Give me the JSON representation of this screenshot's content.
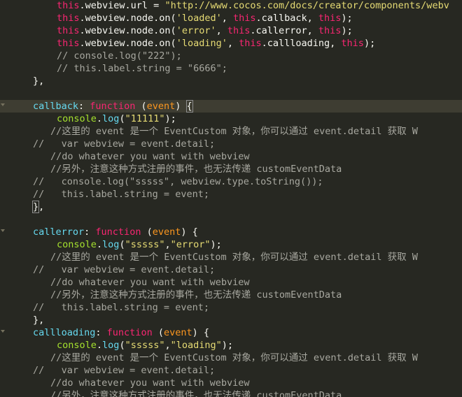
{
  "lines": [
    {
      "indent": "    ",
      "tokens": [
        {
          "t": "this",
          "c": "this"
        },
        {
          "t": ".webview.url = ",
          "c": "plain"
        },
        {
          "t": "\"http://www.cocos.com/docs/creator/components/webv",
          "c": "str"
        }
      ]
    },
    {
      "indent": "    ",
      "tokens": [
        {
          "t": "this",
          "c": "this"
        },
        {
          "t": ".webview.node.on(",
          "c": "plain"
        },
        {
          "t": "'loaded'",
          "c": "str"
        },
        {
          "t": ", ",
          "c": "plain"
        },
        {
          "t": "this",
          "c": "this"
        },
        {
          "t": ".callback, ",
          "c": "plain"
        },
        {
          "t": "this",
          "c": "this"
        },
        {
          "t": ");",
          "c": "plain"
        }
      ]
    },
    {
      "indent": "    ",
      "tokens": [
        {
          "t": "this",
          "c": "this"
        },
        {
          "t": ".webview.node.on(",
          "c": "plain"
        },
        {
          "t": "'error'",
          "c": "str"
        },
        {
          "t": ", ",
          "c": "plain"
        },
        {
          "t": "this",
          "c": "this"
        },
        {
          "t": ".callerror, ",
          "c": "plain"
        },
        {
          "t": "this",
          "c": "this"
        },
        {
          "t": ");",
          "c": "plain"
        }
      ]
    },
    {
      "indent": "    ",
      "tokens": [
        {
          "t": "this",
          "c": "this"
        },
        {
          "t": ".webview.node.on(",
          "c": "plain"
        },
        {
          "t": "'loading'",
          "c": "str"
        },
        {
          "t": ", ",
          "c": "plain"
        },
        {
          "t": "this",
          "c": "this"
        },
        {
          "t": ".callloading, ",
          "c": "plain"
        },
        {
          "t": "this",
          "c": "this"
        },
        {
          "t": ");",
          "c": "plain"
        }
      ]
    },
    {
      "indent": "    ",
      "tokens": [
        {
          "t": "// console.log(\"222\");",
          "c": "cmt"
        }
      ]
    },
    {
      "indent": "    ",
      "tokens": [
        {
          "t": "// this.label.string = \"6666\";",
          "c": "cmt"
        }
      ]
    },
    {
      "indent": "",
      "tokens": [
        {
          "t": "},",
          "c": "plain"
        }
      ]
    },
    {
      "indent": "",
      "tokens": []
    },
    {
      "indent": "",
      "fold": true,
      "active": true,
      "tokens": [
        {
          "t": "callback",
          "c": "fnname"
        },
        {
          "t": ": ",
          "c": "plain"
        },
        {
          "t": "function",
          "c": "kw"
        },
        {
          "t": " (",
          "c": "plain"
        },
        {
          "t": "event",
          "c": "param"
        },
        {
          "t": ") ",
          "c": "plain"
        },
        {
          "t": "{",
          "c": "plain",
          "hl": true
        }
      ]
    },
    {
      "indent": "    ",
      "tokens": [
        {
          "t": "console",
          "c": "fn"
        },
        {
          "t": ".",
          "c": "plain"
        },
        {
          "t": "log",
          "c": "method"
        },
        {
          "t": "(",
          "c": "plain"
        },
        {
          "t": "\"11111\"",
          "c": "str"
        },
        {
          "t": ");",
          "c": "plain"
        }
      ]
    },
    {
      "indent": "   ",
      "tokens": [
        {
          "t": "//这里的 event 是一个 EventCustom 对象，你可以通过 event.detail 获取 W",
          "c": "cmt"
        }
      ]
    },
    {
      "indent": "",
      "tokens": [
        {
          "t": "//   var webview = event.detail;",
          "c": "cmt"
        }
      ]
    },
    {
      "indent": "   ",
      "tokens": [
        {
          "t": "//do whatever you want with webview",
          "c": "cmt"
        }
      ]
    },
    {
      "indent": "   ",
      "tokens": [
        {
          "t": "//另外，注意这种方式注册的事件，也无法传递 customEventData",
          "c": "cmt"
        }
      ]
    },
    {
      "indent": "",
      "tokens": [
        {
          "t": "//   console.log(\"sssss\", webview.type.toString());",
          "c": "cmt"
        }
      ]
    },
    {
      "indent": "",
      "tokens": [
        {
          "t": "//   this.label.string = event;",
          "c": "cmt"
        }
      ]
    },
    {
      "indent": "",
      "tokens": [
        {
          "t": "}",
          "c": "plain",
          "hl": true
        },
        {
          "t": ",",
          "c": "plain"
        }
      ]
    },
    {
      "indent": "",
      "tokens": []
    },
    {
      "indent": "",
      "fold": true,
      "tokens": [
        {
          "t": "callerror",
          "c": "fnname"
        },
        {
          "t": ": ",
          "c": "plain"
        },
        {
          "t": "function",
          "c": "kw"
        },
        {
          "t": " (",
          "c": "plain"
        },
        {
          "t": "event",
          "c": "param"
        },
        {
          "t": ") {",
          "c": "plain"
        }
      ]
    },
    {
      "indent": "    ",
      "tokens": [
        {
          "t": "console",
          "c": "fn"
        },
        {
          "t": ".",
          "c": "plain"
        },
        {
          "t": "log",
          "c": "method"
        },
        {
          "t": "(",
          "c": "plain"
        },
        {
          "t": "\"sssss\"",
          "c": "str"
        },
        {
          "t": ",",
          "c": "plain"
        },
        {
          "t": "\"error\"",
          "c": "str"
        },
        {
          "t": ");",
          "c": "plain"
        }
      ]
    },
    {
      "indent": "   ",
      "tokens": [
        {
          "t": "//这里的 event 是一个 EventCustom 对象，你可以通过 event.detail 获取 W",
          "c": "cmt"
        }
      ]
    },
    {
      "indent": "",
      "tokens": [
        {
          "t": "//   var webview = event.detail;",
          "c": "cmt"
        }
      ]
    },
    {
      "indent": "   ",
      "tokens": [
        {
          "t": "//do whatever you want with webview",
          "c": "cmt"
        }
      ]
    },
    {
      "indent": "   ",
      "tokens": [
        {
          "t": "//另外，注意这种方式注册的事件，也无法传递 customEventData",
          "c": "cmt"
        }
      ]
    },
    {
      "indent": "",
      "tokens": [
        {
          "t": "//   this.label.string = event;",
          "c": "cmt"
        }
      ]
    },
    {
      "indent": "",
      "tokens": [
        {
          "t": "},",
          "c": "plain"
        }
      ]
    },
    {
      "indent": "",
      "fold": true,
      "tokens": [
        {
          "t": "callloading",
          "c": "fnname"
        },
        {
          "t": ": ",
          "c": "plain"
        },
        {
          "t": "function",
          "c": "kw"
        },
        {
          "t": " (",
          "c": "plain"
        },
        {
          "t": "event",
          "c": "param"
        },
        {
          "t": ") {",
          "c": "plain"
        }
      ]
    },
    {
      "indent": "    ",
      "tokens": [
        {
          "t": "console",
          "c": "fn"
        },
        {
          "t": ".",
          "c": "plain"
        },
        {
          "t": "log",
          "c": "method"
        },
        {
          "t": "(",
          "c": "plain"
        },
        {
          "t": "\"sssss\"",
          "c": "str"
        },
        {
          "t": ",",
          "c": "plain"
        },
        {
          "t": "\"loading\"",
          "c": "str"
        },
        {
          "t": ");",
          "c": "plain"
        }
      ]
    },
    {
      "indent": "   ",
      "tokens": [
        {
          "t": "//这里的 event 是一个 EventCustom 对象，你可以通过 event.detail 获取 W",
          "c": "cmt"
        }
      ]
    },
    {
      "indent": "",
      "tokens": [
        {
          "t": "//   var webview = event.detail;",
          "c": "cmt"
        }
      ]
    },
    {
      "indent": "   ",
      "tokens": [
        {
          "t": "//do whatever you want with webview",
          "c": "cmt"
        }
      ]
    },
    {
      "indent": "   ",
      "tokens": [
        {
          "t": "//另外，注意这种方式注册的事件，也无法传递 customEventData",
          "c": "cmt"
        }
      ]
    }
  ],
  "colors": {
    "background": "#272822",
    "active_line": "#3e3d32",
    "keyword": "#f92672",
    "string": "#e6db74",
    "function_name": "#66d9ef",
    "console": "#a6e22e",
    "param": "#fd971f",
    "comment": "#a8a8a0"
  }
}
